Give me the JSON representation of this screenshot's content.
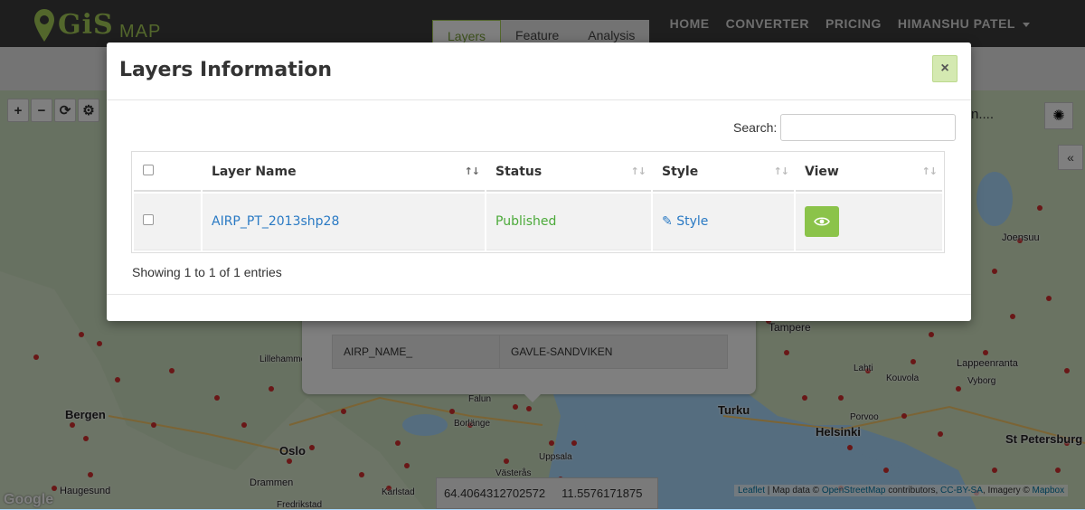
{
  "app": {
    "logo_text": "GiS",
    "logo_map": "MAP"
  },
  "nav": {
    "links": [
      "HOME",
      "CONVERTER",
      "PRICING",
      "HIMANSHU PATEL"
    ],
    "tabs": [
      "Layers",
      "Feature",
      "Analysis"
    ]
  },
  "map": {
    "search_hint": "n....",
    "cities": [
      "Bergen",
      "Oslo",
      "Drammen",
      "Lillehammer",
      "Haugesund",
      "Fredrikstad",
      "Falun",
      "Borlänge",
      "Uppsala",
      "Västerås",
      "Karlstad",
      "Turku",
      "Helsinki",
      "Tampere",
      "Lahti",
      "Kouvola",
      "Porvoo",
      "Lappeenranta",
      "Vyborg",
      "Joensuu",
      "St Petersburg"
    ],
    "popup": {
      "key": "AIRP_NAME_",
      "value": "GAVLE-SANDVIKEN"
    },
    "coords": {
      "lat": "64.4064312702572",
      "lng": "11.5576171875"
    },
    "attribution": {
      "leaflet": "Leaflet",
      "text1": " | Map data © ",
      "osm": "OpenStreetMap",
      "text2": " contributors, ",
      "cc": "CC-BY-SA",
      "text3": ", Imagery © ",
      "mapbox": "Mapbox"
    },
    "google_logo": "Google"
  },
  "modal": {
    "title": "Layers Information",
    "close_label": "×",
    "search_label": "Search:",
    "search_value": "",
    "columns": [
      "Layer Name",
      "Status",
      "Style",
      "View"
    ],
    "rows": [
      {
        "layer_name": "AIRP_PT_2013shp28",
        "status": "Published",
        "style": "Style"
      }
    ],
    "info": "Showing 1 to 1 of 1 entries"
  },
  "colors": {
    "accent_green": "#8bc34a",
    "link_blue": "#2a7ac4",
    "published_green": "#4caa3a"
  }
}
